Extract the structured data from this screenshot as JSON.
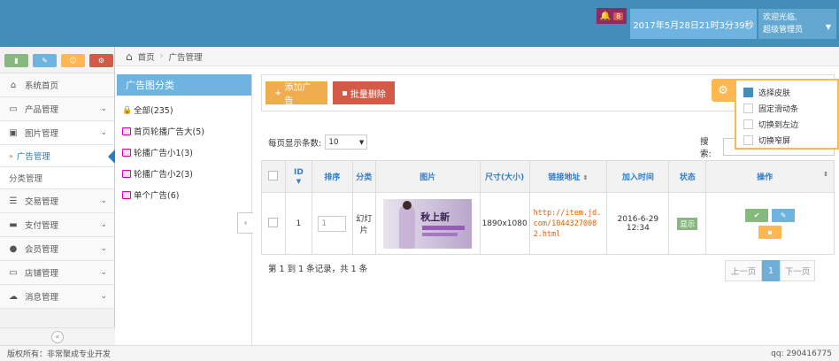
{
  "header": {
    "notification_count": "8",
    "datetime": "2017年5月28日21时3分39秒",
    "user_line1": "欢迎光临,",
    "user_line2": "超级管理员"
  },
  "sidebar": {
    "shortcuts": [
      "signal-icon",
      "pencil-icon",
      "users-icon",
      "cogs-icon"
    ],
    "items": [
      {
        "label": "系统首页",
        "icon": "home-icon"
      },
      {
        "label": "产品管理",
        "icon": "desktop-icon"
      },
      {
        "label": "图片管理",
        "icon": "picture-icon"
      },
      {
        "label": "交易管理",
        "icon": "list-icon"
      },
      {
        "label": "支付管理",
        "icon": "card-icon"
      },
      {
        "label": "会员管理",
        "icon": "user-icon"
      },
      {
        "label": "店铺管理",
        "icon": "laptop-icon"
      },
      {
        "label": "消息管理",
        "icon": "comments-icon"
      }
    ],
    "subitems": [
      "广告管理",
      "分类管理"
    ]
  },
  "breadcrumb": {
    "home": "首页",
    "current": "广告管理"
  },
  "categories": {
    "title": "广告图分类",
    "items": [
      "全部(235)",
      "首页轮播广告大(5)",
      "轮播广告小1(3)",
      "轮播广告小2(3)",
      "单个广告(6)"
    ]
  },
  "toolbar": {
    "add_label": "添加广告",
    "delete_label": "批量删除"
  },
  "listing": {
    "perpage_label": "每页显示条数:",
    "perpage_value": "10",
    "search_label": "搜索:"
  },
  "table": {
    "headers": [
      "ID",
      "排序",
      "分类",
      "图片",
      "尺寸(大小)",
      "链接地址",
      "加入时间",
      "状态",
      "操作"
    ],
    "row": {
      "id": "1",
      "sort_placeholder": "1",
      "category": "幻灯片",
      "image_text": "秋上新",
      "size": "1890x1080",
      "link": "http://item.jd.com/10443270082.html",
      "time": "2016-6-29 12:34",
      "status": "显示"
    }
  },
  "pagination": {
    "info": "第 1 到 1 条记录，共 1 条",
    "prev": "上一页",
    "page": "1",
    "next": "下一页"
  },
  "skin_panel": {
    "options": [
      "选择皮肤",
      "固定滑动条",
      "切换到左边",
      "切换窄屏"
    ]
  },
  "footer": {
    "left": "版权所有：非常聚成专业开发",
    "right": "qq: 290416775"
  }
}
